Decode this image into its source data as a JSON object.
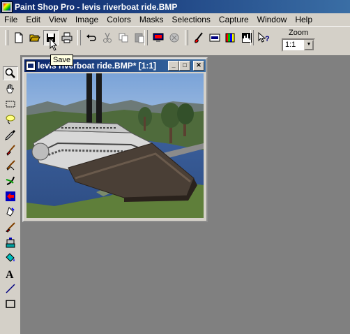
{
  "app": {
    "title": "Paint Shop Pro - levis riverboat ride.BMP"
  },
  "menubar": {
    "items": [
      "File",
      "Edit",
      "View",
      "Image",
      "Colors",
      "Masks",
      "Selections",
      "Capture",
      "Window",
      "Help"
    ]
  },
  "toolbar": {
    "zoom_label": "Zoom",
    "zoom_value": "1:1",
    "tooltip": "Save"
  },
  "document": {
    "title": "levis riverboat ride.BMP* [1:1]"
  },
  "colors": {
    "titlebar_start": "#0a246a",
    "titlebar_end": "#3a6ea5",
    "face": "#d4d0c8",
    "workspace": "#808080",
    "tooltip_bg": "#ffffe1"
  }
}
